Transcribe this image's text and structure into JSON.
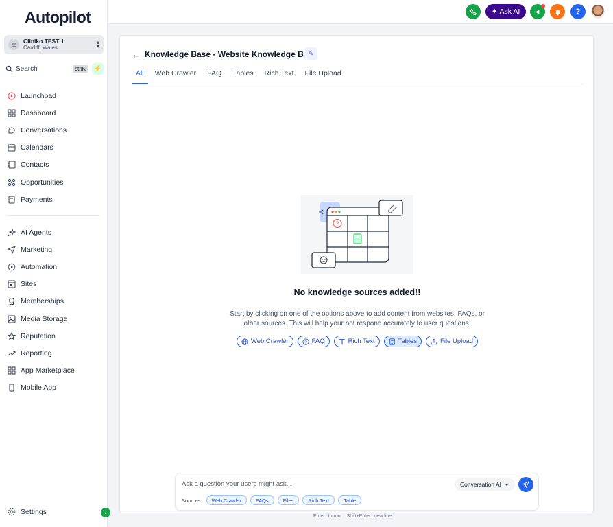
{
  "brand": {
    "logo_text": "Autopilot"
  },
  "account": {
    "name": "Cliniko TEST 1",
    "location": "Cardiff, Wales"
  },
  "search": {
    "label": "Search",
    "shortcut": "ctrlK"
  },
  "nav_primary": [
    {
      "label": "Launchpad",
      "icon": "rocket-icon"
    },
    {
      "label": "Dashboard",
      "icon": "grid-icon"
    },
    {
      "label": "Conversations",
      "icon": "chat-icon"
    },
    {
      "label": "Calendars",
      "icon": "calendar-icon"
    },
    {
      "label": "Contacts",
      "icon": "contacts-icon"
    },
    {
      "label": "Opportunities",
      "icon": "opportunities-icon"
    },
    {
      "label": "Payments",
      "icon": "payments-icon"
    }
  ],
  "nav_secondary": [
    {
      "label": "AI Agents",
      "icon": "sparkle-icon"
    },
    {
      "label": "Marketing",
      "icon": "send-icon"
    },
    {
      "label": "Automation",
      "icon": "automation-icon"
    },
    {
      "label": "Sites",
      "icon": "sites-icon"
    },
    {
      "label": "Memberships",
      "icon": "membership-icon"
    },
    {
      "label": "Media Storage",
      "icon": "image-icon"
    },
    {
      "label": "Reputation",
      "icon": "star-icon"
    },
    {
      "label": "Reporting",
      "icon": "trend-icon"
    },
    {
      "label": "App Marketplace",
      "icon": "apps-icon"
    },
    {
      "label": "Mobile App",
      "icon": "mobile-icon"
    }
  ],
  "settings": {
    "label": "Settings"
  },
  "topbar": {
    "ask_ai_label": "Ask AI"
  },
  "page": {
    "title": "Knowledge Base - Website Knowledge Base",
    "tabs": [
      "All",
      "Web Crawler",
      "FAQ",
      "Tables",
      "Rich Text",
      "File Upload"
    ],
    "active_tab": "All"
  },
  "empty_state": {
    "title": "No knowledge sources added!!",
    "description": "Start by clicking on one of the options above to add content from websites, FAQs, or other sources. This will help your bot respond accurately to user questions.",
    "chips": [
      {
        "label": "Web Crawler",
        "icon": "globe-icon",
        "selected": false
      },
      {
        "label": "FAQ",
        "icon": "question-icon",
        "selected": false
      },
      {
        "label": "Rich Text",
        "icon": "text-icon",
        "selected": false
      },
      {
        "label": "Tables",
        "icon": "table-icon",
        "selected": true
      },
      {
        "label": "File Upload",
        "icon": "upload-icon",
        "selected": false
      }
    ]
  },
  "ask_box": {
    "placeholder": "Ask a question your users might ask...",
    "mode": "Conversation AI",
    "sources_label": "Sources:",
    "sources": [
      "Web Crawler",
      "FAQs",
      "Files",
      "Rich Text",
      "Table"
    ]
  },
  "hints": {
    "enter_key": "Enter",
    "enter_text": "to run",
    "shift_key": "Shift+Enter",
    "shift_text": "new line"
  },
  "colors": {
    "accent": "#2563eb",
    "ask_ai_bg": "#3b0a8a",
    "phone_green": "#16a34a",
    "bell_orange": "#f97316",
    "help_blue": "#2563eb"
  }
}
